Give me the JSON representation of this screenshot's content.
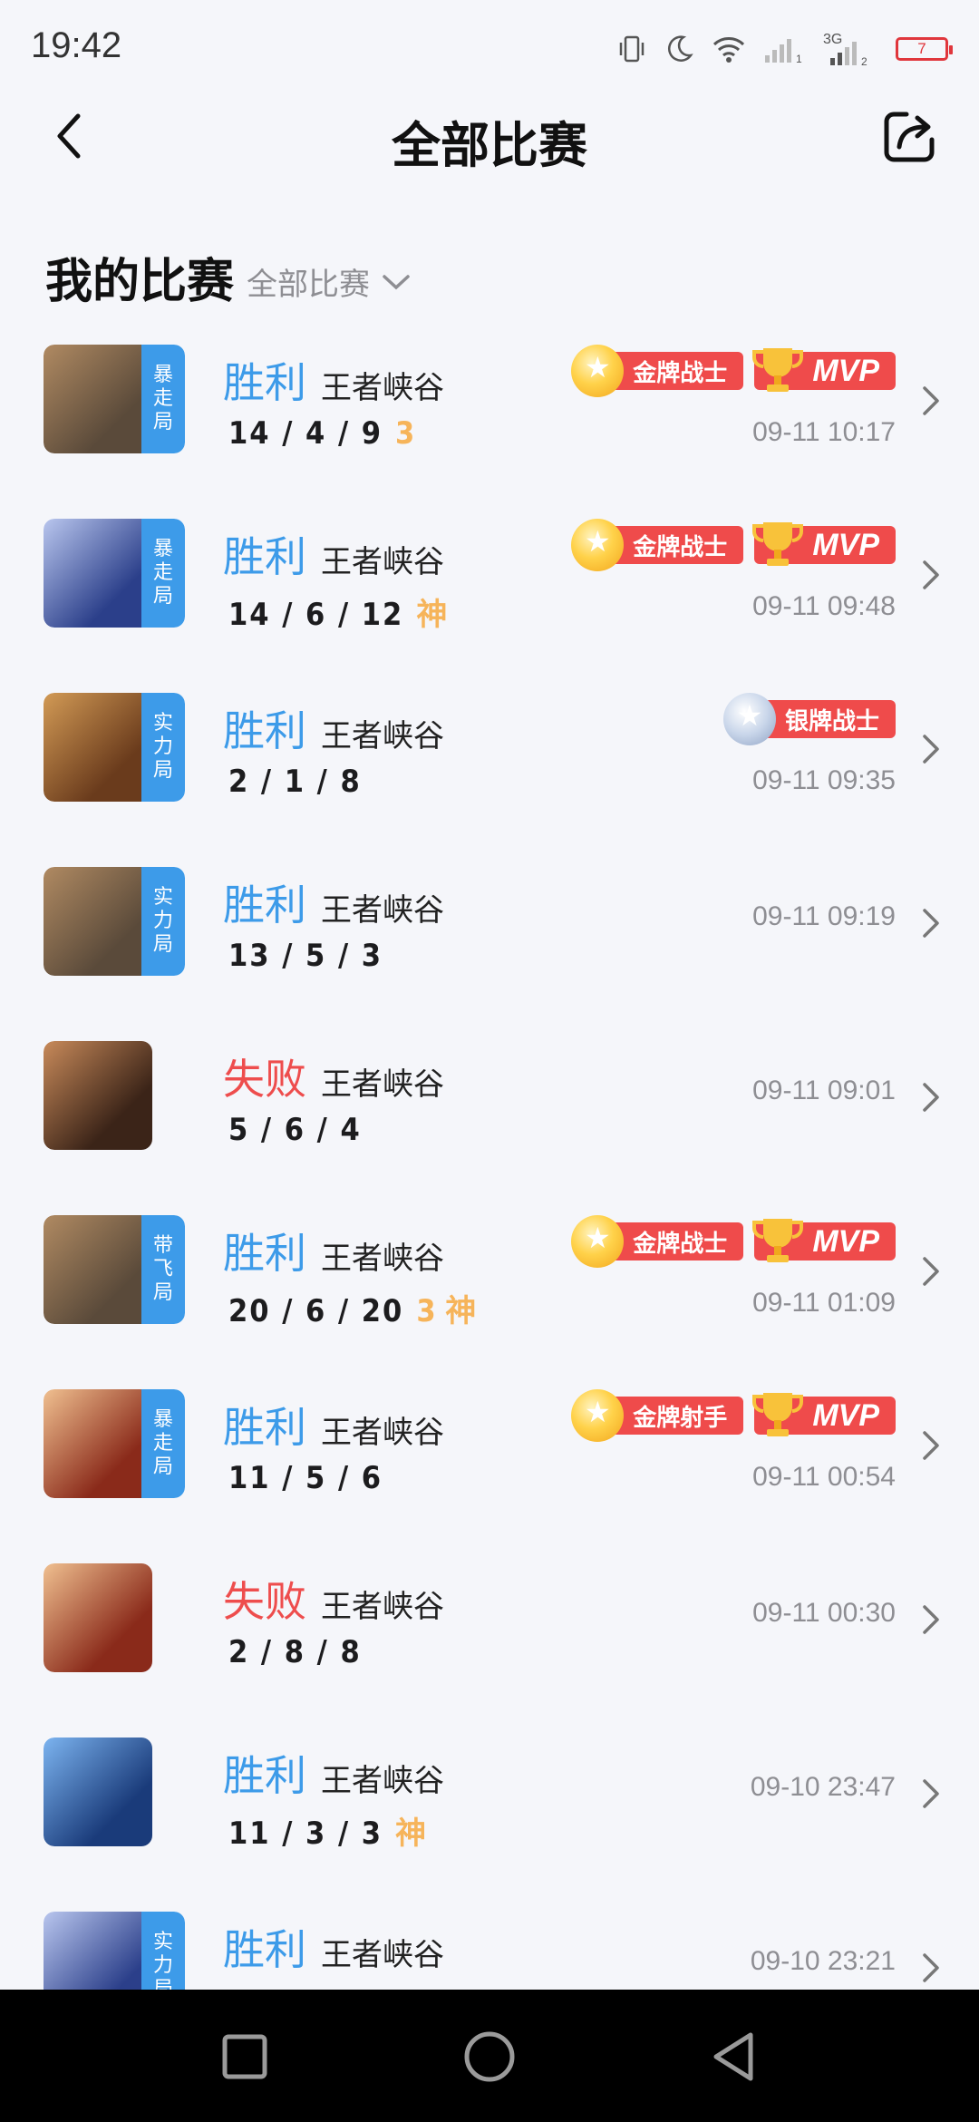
{
  "status_bar": {
    "time": "19:42",
    "network_label": "3G",
    "sim1": "1",
    "sim2": "2",
    "battery": "7",
    "icons": [
      "vibrate-icon",
      "moon-icon",
      "wifi-icon",
      "signal-icon",
      "signal-icon",
      "battery-icon"
    ]
  },
  "header": {
    "title": "全部比赛",
    "back_icon": "back-arrow-icon",
    "share_icon": "share-icon"
  },
  "section": {
    "title": "我的比赛",
    "filter_label": "全部比赛"
  },
  "colors": {
    "win": "#3d9be9",
    "lose": "#ee4d4d",
    "badge_red": "#ef4b4b",
    "tag_gold": "#f6b45a"
  },
  "matches": [
    {
      "mode": "暴走局",
      "result": "胜利",
      "outcome": "win",
      "map": "王者峡谷",
      "kda": "14 / 4 / 9",
      "tag": "3",
      "time": "09-11 10:17",
      "badges": [
        {
          "label": "金牌战士",
          "kind": "gold"
        },
        {
          "label": "MVP",
          "kind": "mvp"
        }
      ],
      "art": [
        "#5a4a3a",
        "#b08a62"
      ]
    },
    {
      "mode": "暴走局",
      "result": "胜利",
      "outcome": "win",
      "map": "王者峡谷",
      "kda": "14 / 6 / 12",
      "tag": "神",
      "time": "09-11 09:48",
      "badges": [
        {
          "label": "金牌战士",
          "kind": "gold"
        },
        {
          "label": "MVP",
          "kind": "mvp"
        }
      ],
      "art": [
        "#2b3f8a",
        "#b9c6ee"
      ]
    },
    {
      "mode": "实力局",
      "result": "胜利",
      "outcome": "win",
      "map": "王者峡谷",
      "kda": "2 / 1 / 8",
      "tag": "",
      "time": "09-11 09:35",
      "badges": [
        {
          "label": "银牌战士",
          "kind": "silver"
        }
      ],
      "art": [
        "#6a3b1c",
        "#d29a55"
      ]
    },
    {
      "mode": "实力局",
      "result": "胜利",
      "outcome": "win",
      "map": "王者峡谷",
      "kda": "13 / 5 / 3",
      "tag": "",
      "time": "09-11 09:19",
      "badges": [],
      "art": [
        "#5a4a3a",
        "#b08a62"
      ]
    },
    {
      "mode": "",
      "result": "失败",
      "outcome": "lose",
      "map": "王者峡谷",
      "kda": "5 / 6 / 4",
      "tag": "",
      "time": "09-11 09:01",
      "badges": [],
      "art": [
        "#3b2418",
        "#c88a5a"
      ]
    },
    {
      "mode": "带飞局",
      "result": "胜利",
      "outcome": "win",
      "map": "王者峡谷",
      "kda": "20 / 6 / 20",
      "tag": "3 神",
      "time": "09-11 01:09",
      "badges": [
        {
          "label": "金牌战士",
          "kind": "gold"
        },
        {
          "label": "MVP",
          "kind": "mvp"
        }
      ],
      "art": [
        "#5a4a3a",
        "#b08a62"
      ]
    },
    {
      "mode": "暴走局",
      "result": "胜利",
      "outcome": "win",
      "map": "王者峡谷",
      "kda": "11 / 5 / 6",
      "tag": "",
      "time": "09-11 00:54",
      "badges": [
        {
          "label": "金牌射手",
          "kind": "gold"
        },
        {
          "label": "MVP",
          "kind": "mvp"
        }
      ],
      "art": [
        "#8a2a1a",
        "#f0c090"
      ]
    },
    {
      "mode": "",
      "result": "失败",
      "outcome": "lose",
      "map": "王者峡谷",
      "kda": "2 / 8 / 8",
      "tag": "",
      "time": "09-11 00:30",
      "badges": [],
      "art": [
        "#8a2a1a",
        "#f0c090"
      ]
    },
    {
      "mode": "",
      "result": "胜利",
      "outcome": "win",
      "map": "王者峡谷",
      "kda": "11 / 3 / 3",
      "tag": "神",
      "time": "09-10 23:47",
      "badges": [],
      "art": [
        "#1a3b7a",
        "#7cb4f0"
      ]
    },
    {
      "mode": "实力局",
      "result": "胜利",
      "outcome": "win",
      "map": "王者峡谷",
      "kda": "",
      "tag": "",
      "time": "09-10 23:21",
      "badges": [],
      "art": [
        "#2b3f8a",
        "#b9c6ee"
      ]
    }
  ],
  "nav": {
    "icons": [
      "recent-apps-icon",
      "home-icon",
      "back-icon"
    ]
  }
}
